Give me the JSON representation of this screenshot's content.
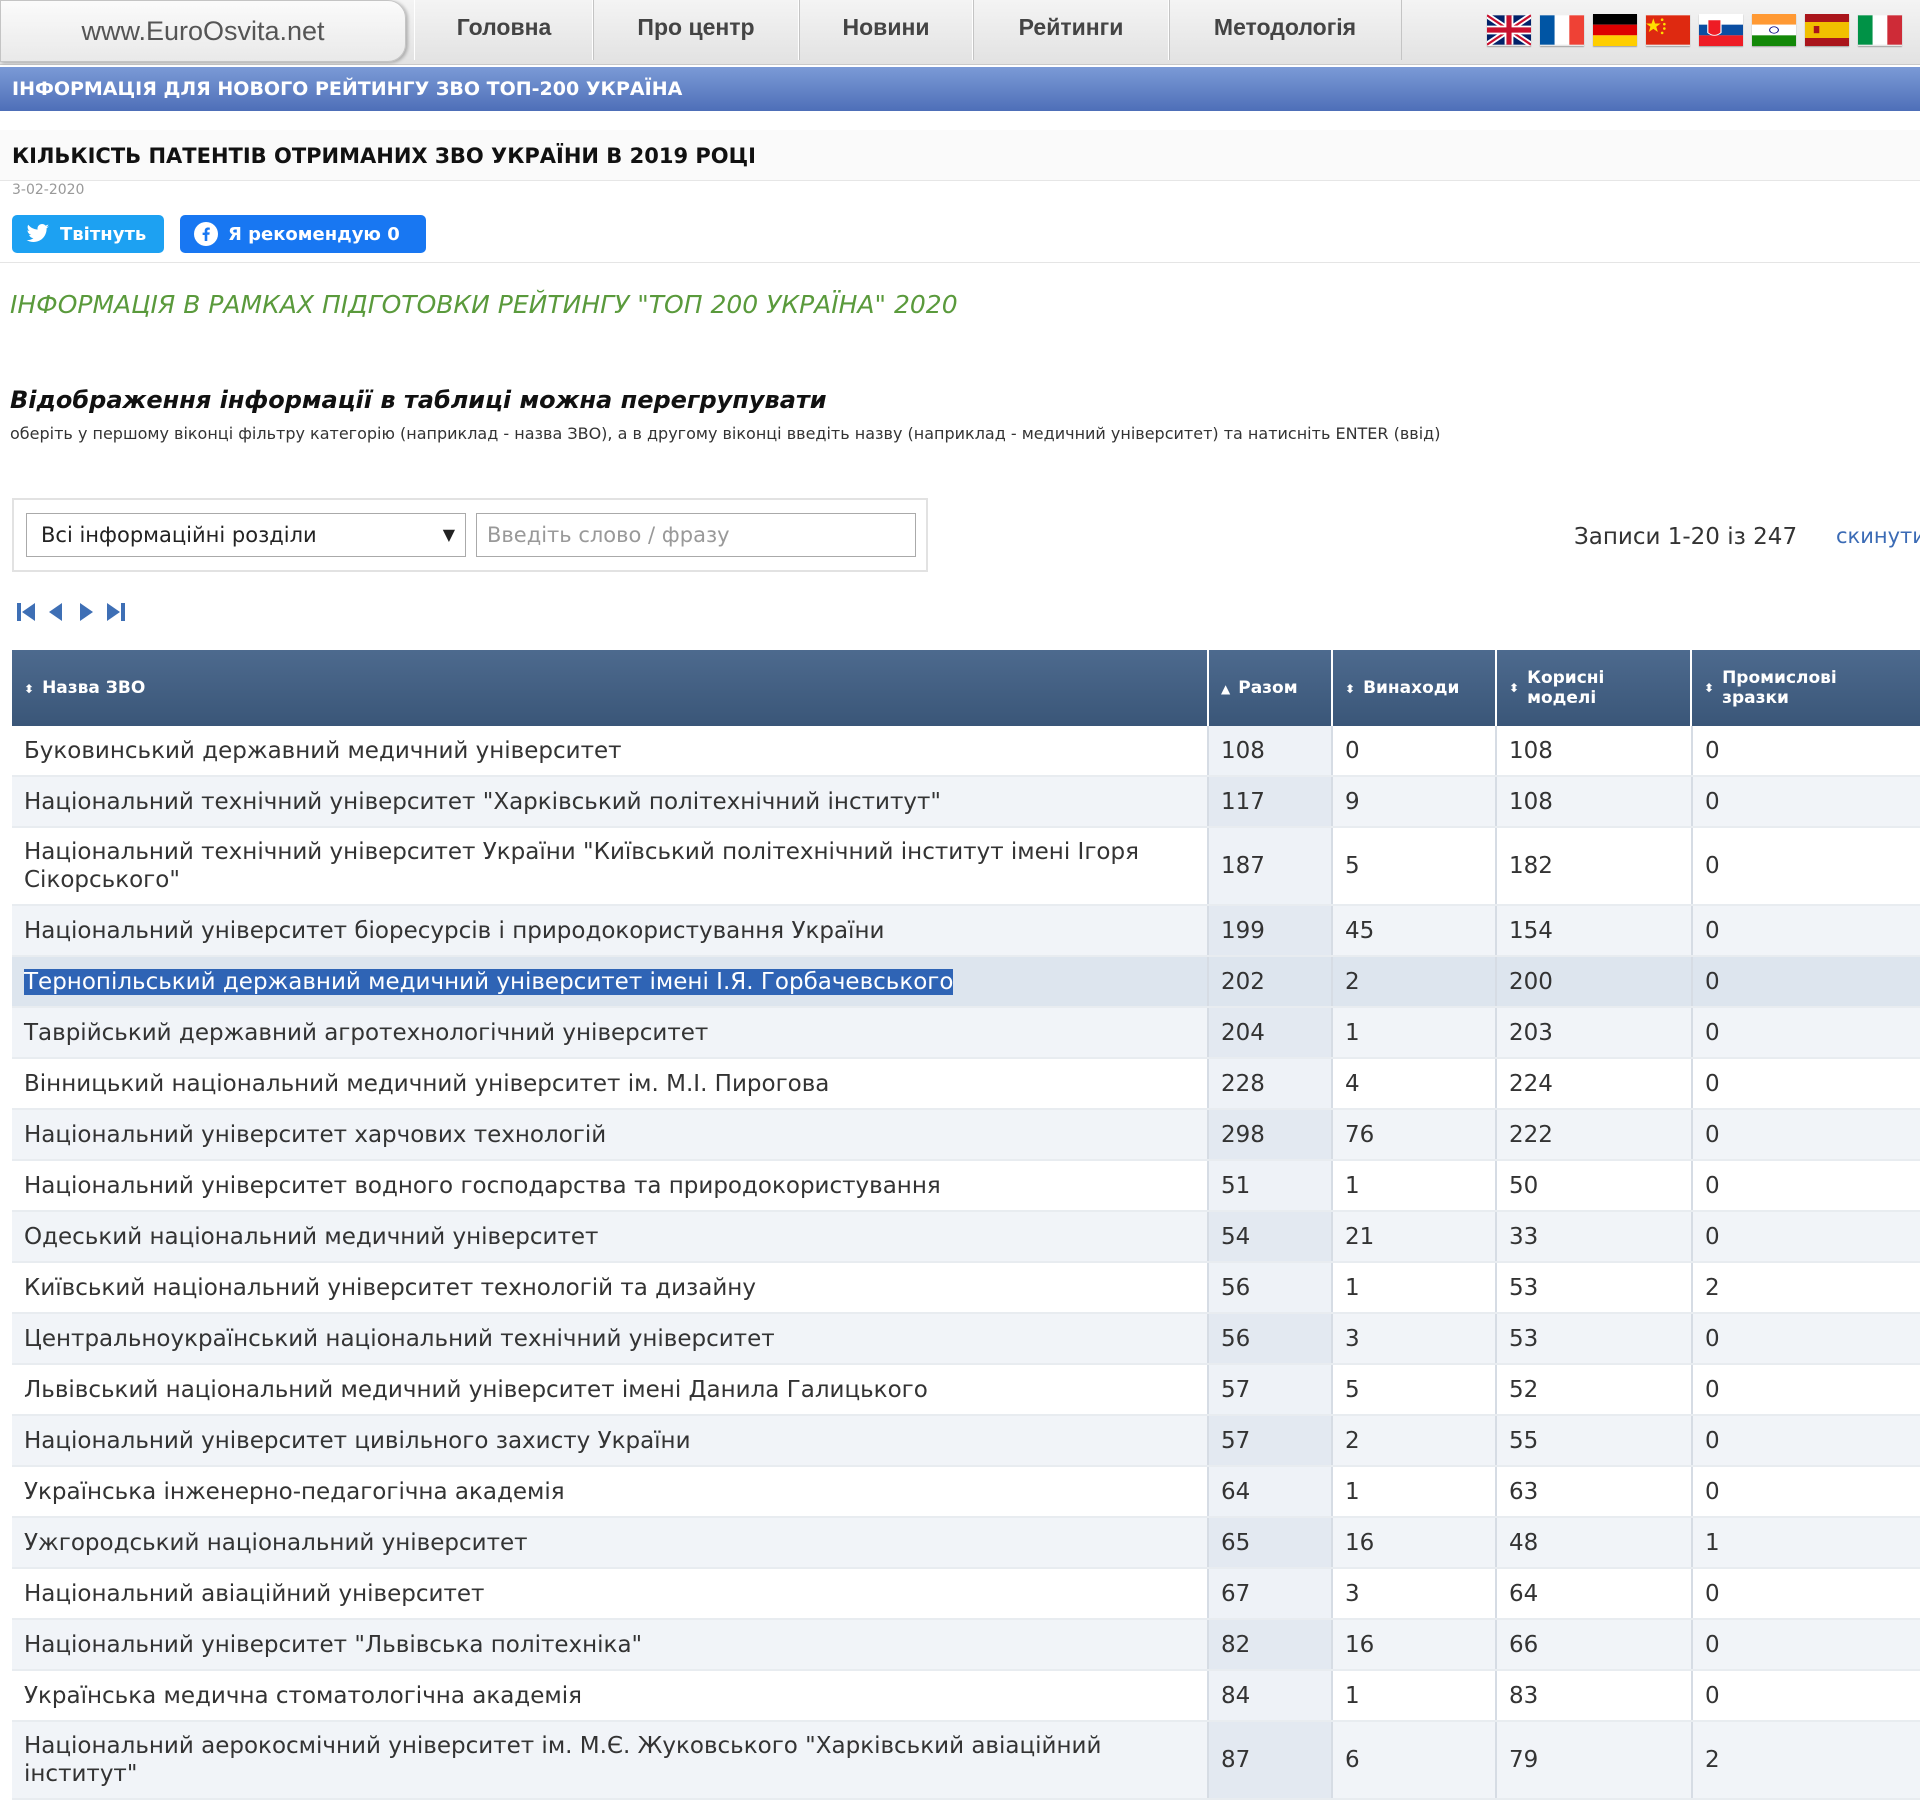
{
  "site": {
    "logo": "www.EuroOsvita.net"
  },
  "nav": [
    {
      "label": "Головна"
    },
    {
      "label": "Про центр"
    },
    {
      "label": "Новини"
    },
    {
      "label": "Рейтинги"
    },
    {
      "label": "Методологія"
    }
  ],
  "flags": [
    "uk-flag-icon",
    "france-flag-icon",
    "germany-flag-icon",
    "china-flag-icon",
    "slovakia-flag-icon",
    "india-flag-icon",
    "spain-flag-icon",
    "italy-flag-icon"
  ],
  "info_bar": "ІНФОРМАЦІЯ ДЛЯ НОВОГО РЕЙТИНГУ ЗВО ТОП-200 УКРАЇНА",
  "article": {
    "title": "КІЛЬКІСТЬ ПАТЕНТІВ ОТРИМАНИХ ЗВО УКРАЇНИ В 2019 РОЦІ",
    "date": "3-02-2020",
    "tweet_label": "Твітнуть",
    "fb_label": "Я рекомендую 0",
    "green_note": "ІНФОРМАЦІЯ В РАМКАХ ПІДГОТОВКИ РЕЙТИНГУ \"ТОП 200 УКРАЇНА\" 2020",
    "filter_heading": "Відображення інформації в таблиці можна перегрупувати",
    "filter_hint": "оберіть у першому віконці фільтру категорію (наприклад - назва ЗВО), а в другому віконці введіть назву (наприклад - медичний університет) та натисніть ENTER (ввід)"
  },
  "filter": {
    "category": "Всі інформаційні розділи",
    "search_placeholder": "Введіть слово / фразу",
    "records": "Записи 1-20 із 247",
    "reset": "скинути"
  },
  "table": {
    "headers": [
      "Назва ЗВО",
      "Разом",
      "Винаходи",
      "Корисні моделі",
      "Промислові зразки"
    ],
    "rows": [
      [
        "Буковинський державний медичний університет",
        "108",
        "0",
        "108",
        "0"
      ],
      [
        "Національний технічний університет \"Харківський політехнічний інститут\"",
        "117",
        "9",
        "108",
        "0"
      ],
      [
        "Національний технічний університет України \"Київський політехнічний інститут імені Ігоря Сікорського\"",
        "187",
        "5",
        "182",
        "0"
      ],
      [
        "Національний університет біоресурсів і природокористування України",
        "199",
        "45",
        "154",
        "0"
      ],
      [
        "Тернопільський державний медичний університет імені І.Я. Горбачевського",
        "202",
        "2",
        "200",
        "0"
      ],
      [
        "Таврійський державний агротехнологічний університет",
        "204",
        "1",
        "203",
        "0"
      ],
      [
        "Вінницький національний медичний університет ім. М.І. Пирогова",
        "228",
        "4",
        "224",
        "0"
      ],
      [
        "Національний університет харчових технологій",
        "298",
        "76",
        "222",
        "0"
      ],
      [
        "Національний університет водного господарства та природокористування",
        "51",
        "1",
        "50",
        "0"
      ],
      [
        "Одеський національний медичний університет",
        "54",
        "21",
        "33",
        "0"
      ],
      [
        "Київський національний університет технологій та дизайну",
        "56",
        "1",
        "53",
        "2"
      ],
      [
        "Центральноукраїнський національний технічний університет",
        "56",
        "3",
        "53",
        "0"
      ],
      [
        "Львівський національний медичний університет імені Данила Галицького",
        "57",
        "5",
        "52",
        "0"
      ],
      [
        "Національний університет цивільного захисту України",
        "57",
        "2",
        "55",
        "0"
      ],
      [
        "Українська інженерно-педагогічна академія",
        "64",
        "1",
        "63",
        "0"
      ],
      [
        "Ужгородський національний університет",
        "65",
        "16",
        "48",
        "1"
      ],
      [
        "Національний авіаційний університет",
        "67",
        "3",
        "64",
        "0"
      ],
      [
        "Національний університет \"Львівська політехніка\"",
        "82",
        "16",
        "66",
        "0"
      ],
      [
        "Українська медична стоматологічна академія",
        "84",
        "1",
        "83",
        "0"
      ],
      [
        "Національний аерокосмічний університет ім. М.Є. Жуковського \"Харківський авіаційний інститут\"",
        "87",
        "6",
        "79",
        "2"
      ]
    ]
  }
}
